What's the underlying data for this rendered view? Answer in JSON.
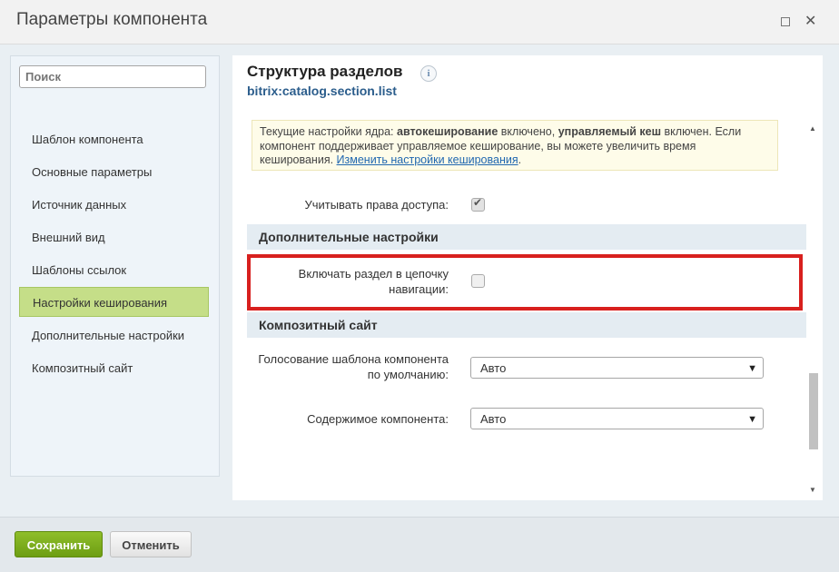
{
  "window": {
    "title": "Параметры компонента"
  },
  "sidebar": {
    "search_placeholder": "Поиск",
    "items": [
      {
        "label": "Шаблон компонента"
      },
      {
        "label": "Основные параметры"
      },
      {
        "label": "Источник данных"
      },
      {
        "label": "Внешний вид"
      },
      {
        "label": "Шаблоны ссылок"
      },
      {
        "label": "Настройки кеширования",
        "active": true
      },
      {
        "label": "Дополнительные настройки"
      },
      {
        "label": "Композитный сайт"
      }
    ]
  },
  "component": {
    "title": "Структура разделов",
    "code": "bitrix:catalog.section.list",
    "info_icon": "i"
  },
  "notice": {
    "prefix": "Текущие настройки ядра: ",
    "bold1": "автокеширование",
    "mid1": " включено, ",
    "bold2": "управляемый кеш",
    "mid2": " включен. Если компонент поддерживает управляемое кеширование, вы можете увеличить время кеширования. ",
    "link": "Изменить настройки кеширования",
    "suffix": "."
  },
  "settings": {
    "access_rights": {
      "label": "Учитывать права доступа:",
      "checked": true
    },
    "additional": {
      "heading": "Дополнительные настройки",
      "nav_chain_line1": "Включать раздел в цепочку",
      "nav_chain_line2": "навигации:",
      "nav_chain_checked": false
    },
    "composite": {
      "heading": "Композитный сайт",
      "voting_line1": "Голосование шаблона компонента",
      "voting_line2": "по умолчанию:",
      "voting_value": "Авто",
      "content_label": "Содержимое компонента:",
      "content_value": "Авто"
    }
  },
  "footer": {
    "save": "Сохранить",
    "cancel": "Отменить"
  },
  "colors": {
    "highlight": "#d8201e",
    "save_button": "#7bac1b",
    "active_nav": "#c5de88"
  }
}
